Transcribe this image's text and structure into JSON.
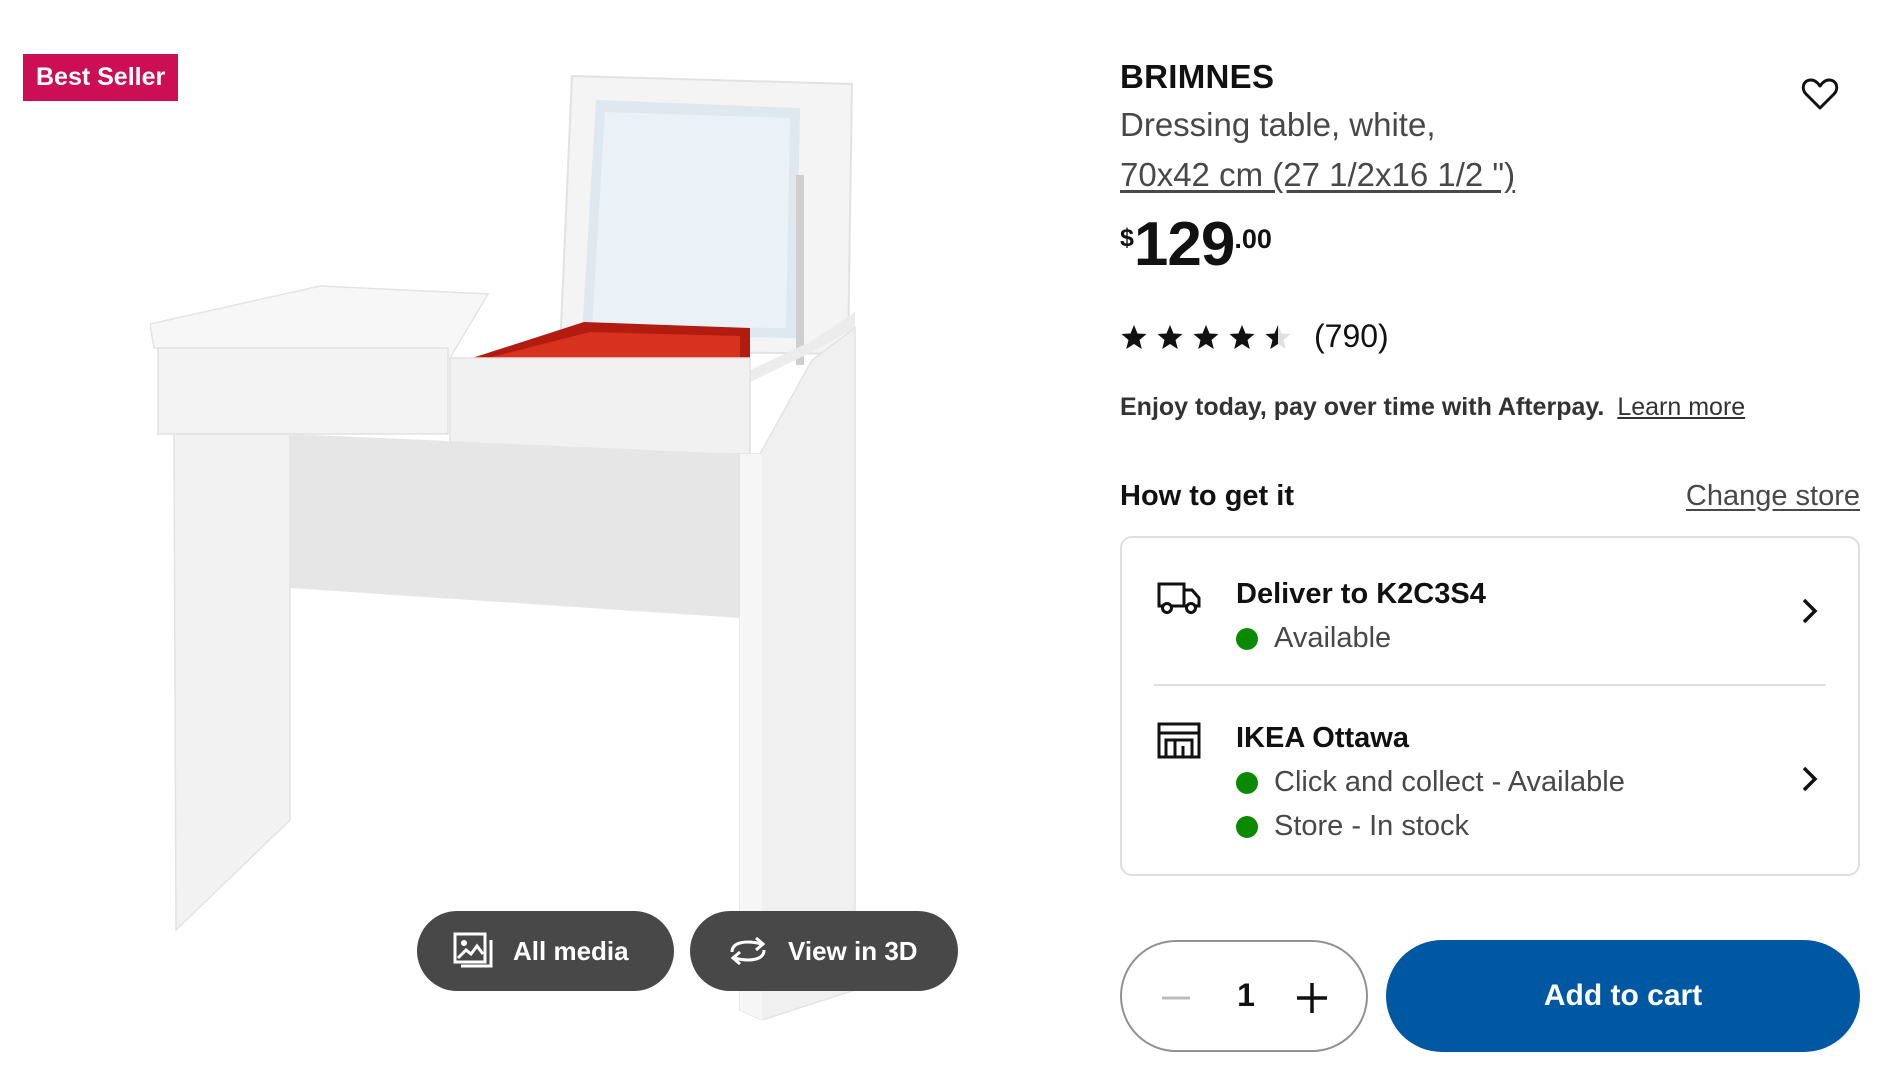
{
  "media": {
    "badge": "Best Seller",
    "all_media_label": "All media",
    "view_3d_label": "View in 3D",
    "image_icon": "gallery-icon",
    "rotate_icon": "rotate-3d-icon"
  },
  "product": {
    "name": "BRIMNES",
    "description": "Dressing table, white,",
    "dimensions": "70x42 cm (27 1/2x16 1/2 \")",
    "price": {
      "currency": "$",
      "integer": "129",
      "decimal": ".00"
    },
    "rating": {
      "value": 4.5,
      "max": 5,
      "count_label": "(790)"
    }
  },
  "afterpay": {
    "text": "Enjoy today, pay over time with Afterpay.",
    "link": "Learn more"
  },
  "fulfillment": {
    "heading": "How to get it",
    "change_store": "Change store",
    "delivery": {
      "title": "Deliver to K2C3S4",
      "status": "Available"
    },
    "store": {
      "title": "IKEA Ottawa",
      "status_1": "Click and collect - Available",
      "status_2": "Store - In stock"
    }
  },
  "cart": {
    "quantity": "1",
    "add_to_cart": "Add to cart"
  },
  "colors": {
    "badge": "#cc0f55",
    "primary_button": "#0058a3",
    "available_dot": "#0a8a00",
    "media_button": "#484848"
  }
}
